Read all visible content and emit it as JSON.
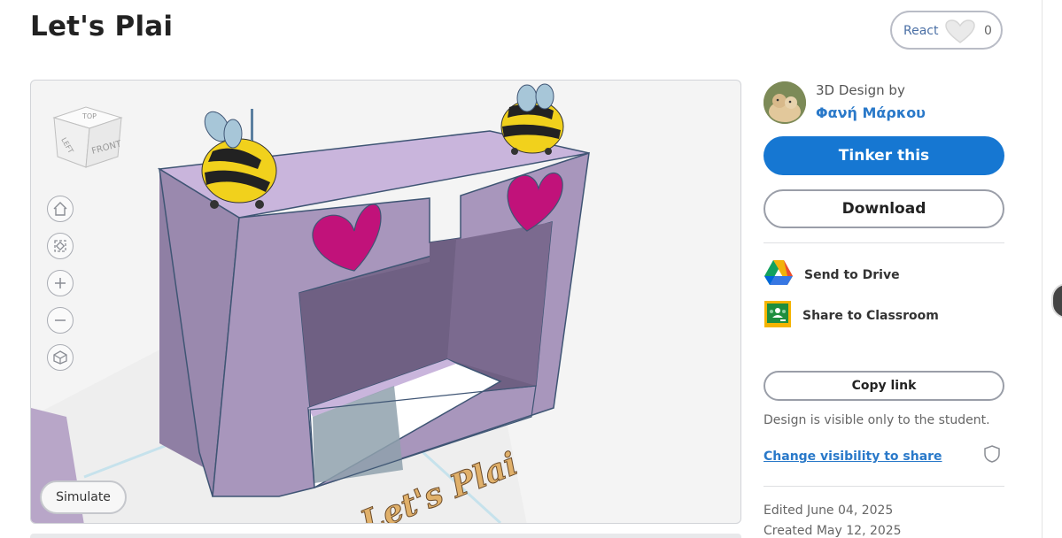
{
  "page": {
    "title": "Let's Plai"
  },
  "react": {
    "label": "React",
    "count": "0"
  },
  "viewer": {
    "viewcube": {
      "top": "TOP",
      "left": "LEFT",
      "front": "FRONT"
    },
    "nav_icons": [
      "home-icon",
      "fit-view-icon",
      "zoom-in-icon",
      "zoom-out-icon",
      "perspective-icon"
    ],
    "simulate_label": "Simulate",
    "model_text": "Let's Plai"
  },
  "author": {
    "design_by": "3D Design by",
    "name": "Φανή Μάρκου"
  },
  "actions": {
    "tinker": "Tinker this",
    "download": "Download",
    "send_drive": "Send to Drive",
    "share_classroom": "Share to Classroom",
    "copy_link": "Copy link"
  },
  "visibility": {
    "note": "Design is visible only to the student.",
    "change_link": "Change visibility to share"
  },
  "meta": {
    "edited": "Edited June 04, 2025",
    "created": "Created May 12, 2025"
  },
  "colors": {
    "primary": "#1677d2",
    "link": "#2a79c9",
    "model_face": "#c9b5dc",
    "heart": "#c1127a",
    "bee_yellow": "#f1d11c"
  }
}
